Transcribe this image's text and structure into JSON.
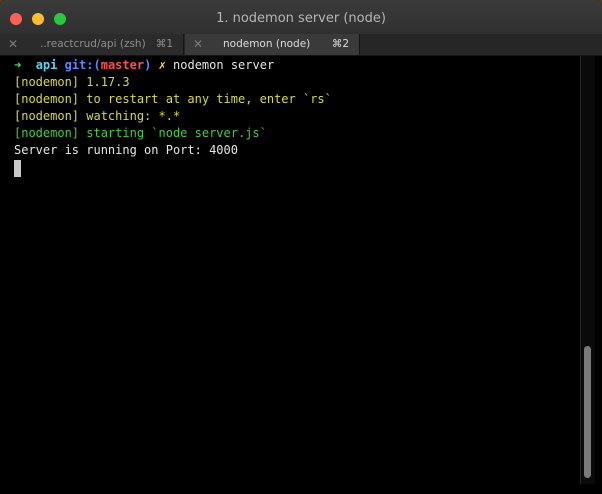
{
  "window": {
    "title": "1. nodemon server (node)"
  },
  "tabs": [
    {
      "label": "..reactcrud/api (zsh)",
      "shortcut": "⌘1",
      "active": false
    },
    {
      "label": "nodemon (node)",
      "shortcut": "⌘2",
      "active": true
    }
  ],
  "icons": {
    "tab_close": "close-icon",
    "prompt_arrow": "arrow-right-icon",
    "dirty_mark": "x-mark-icon"
  },
  "terminal": {
    "prompt": {
      "arrow": "➜",
      "dir": "api",
      "git_label": "git:(",
      "branch": "master",
      "git_close": ")",
      "dirty": "✗",
      "command": "nodemon server"
    },
    "lines": [
      "[nodemon] 1.17.3",
      "[nodemon] to restart at any time, enter `rs`",
      "[nodemon] watching: *.*",
      "[nodemon] starting `node server.js`",
      "Server is running on Port: 4000"
    ]
  },
  "colors": {
    "traffic_close": "#fe5f57",
    "traffic_minimize": "#febc2e",
    "traffic_zoom": "#28c840",
    "prompt_arrow": "#4ee06a",
    "dir": "#5ed4f0",
    "git": "#5f86ff",
    "branch": "#ff4f4f",
    "dirty": "#ffe24a",
    "nodemon_info": "#d8d84a",
    "nodemon_start": "#44cc44"
  }
}
